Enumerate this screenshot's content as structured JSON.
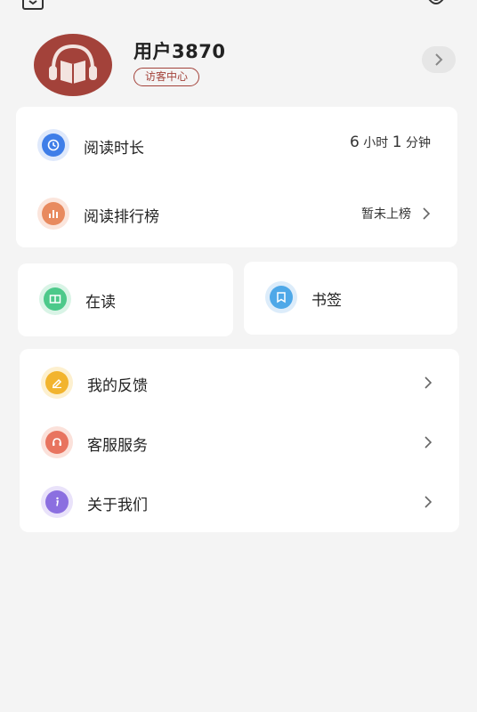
{
  "profile": {
    "username": "用户3870",
    "badge": "访客中心"
  },
  "stats_card": {
    "reading_time": {
      "label": "阅读时长",
      "hours": "6",
      "hours_unit": "小时",
      "minutes": "1",
      "minutes_unit": "分钟",
      "icon": "clock-icon",
      "color": "#3f7ee8"
    },
    "ranking": {
      "label": "阅读排行榜",
      "value": "暂未上榜",
      "icon": "bar-chart-icon",
      "color": "#e88a5f"
    }
  },
  "shortcuts": {
    "reading": {
      "label": "在读",
      "icon": "open-book-icon",
      "color": "#4cc98a"
    },
    "bookmarks": {
      "label": "书签",
      "icon": "bookmark-icon",
      "color": "#4ea8e8"
    }
  },
  "menu": {
    "feedback": {
      "label": "我的反馈",
      "icon": "edit-icon",
      "color": "#f2b42e"
    },
    "service": {
      "label": "客服服务",
      "icon": "headset-icon",
      "color": "#e8745f"
    },
    "about": {
      "label": "关于我们",
      "icon": "info-icon",
      "color": "#8b6fe0"
    }
  }
}
